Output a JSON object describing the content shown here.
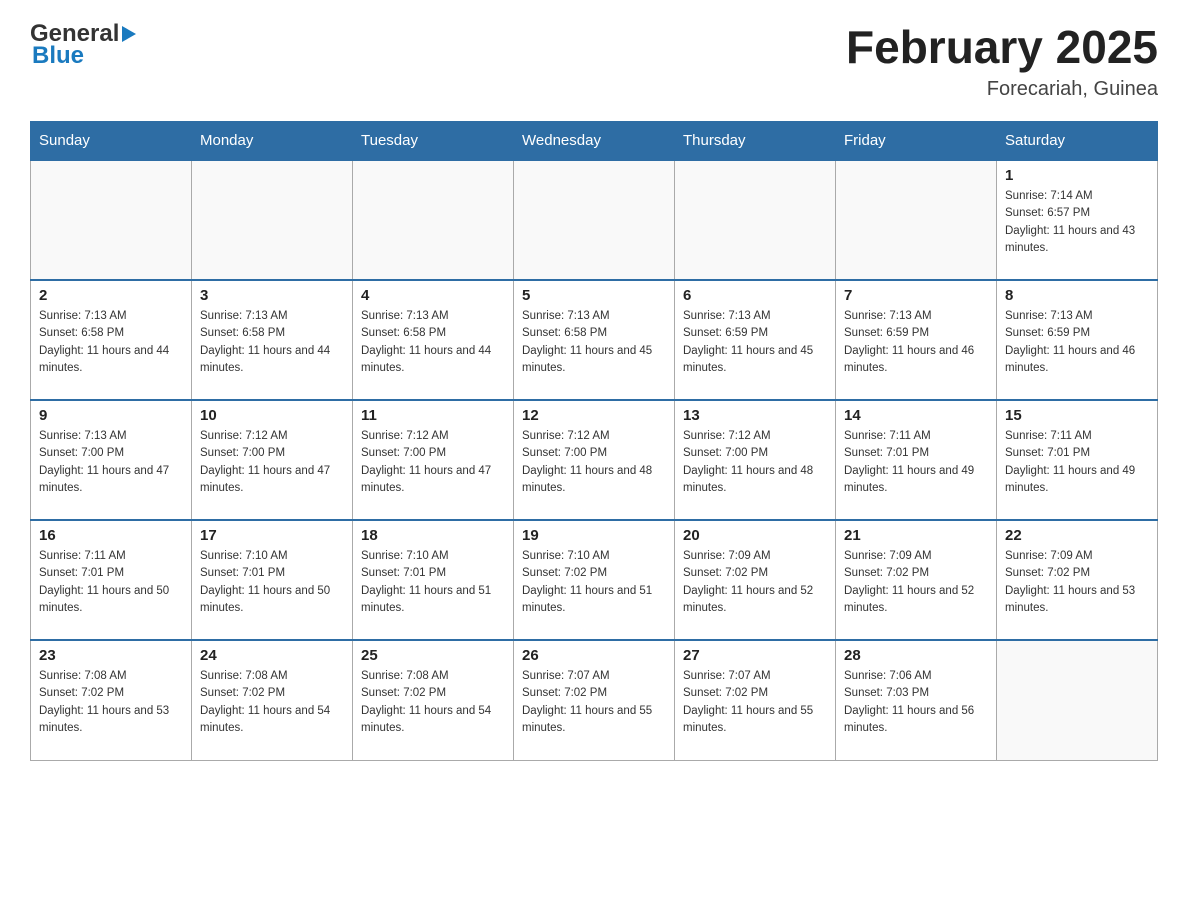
{
  "header": {
    "logo_general": "General",
    "logo_blue": "Blue",
    "month_title": "February 2025",
    "location": "Forecariah, Guinea"
  },
  "weekdays": [
    "Sunday",
    "Monday",
    "Tuesday",
    "Wednesday",
    "Thursday",
    "Friday",
    "Saturday"
  ],
  "weeks": [
    [
      {
        "day": "",
        "sunrise": "",
        "sunset": "",
        "daylight": ""
      },
      {
        "day": "",
        "sunrise": "",
        "sunset": "",
        "daylight": ""
      },
      {
        "day": "",
        "sunrise": "",
        "sunset": "",
        "daylight": ""
      },
      {
        "day": "",
        "sunrise": "",
        "sunset": "",
        "daylight": ""
      },
      {
        "day": "",
        "sunrise": "",
        "sunset": "",
        "daylight": ""
      },
      {
        "day": "",
        "sunrise": "",
        "sunset": "",
        "daylight": ""
      },
      {
        "day": "1",
        "sunrise": "Sunrise: 7:14 AM",
        "sunset": "Sunset: 6:57 PM",
        "daylight": "Daylight: 11 hours and 43 minutes."
      }
    ],
    [
      {
        "day": "2",
        "sunrise": "Sunrise: 7:13 AM",
        "sunset": "Sunset: 6:58 PM",
        "daylight": "Daylight: 11 hours and 44 minutes."
      },
      {
        "day": "3",
        "sunrise": "Sunrise: 7:13 AM",
        "sunset": "Sunset: 6:58 PM",
        "daylight": "Daylight: 11 hours and 44 minutes."
      },
      {
        "day": "4",
        "sunrise": "Sunrise: 7:13 AM",
        "sunset": "Sunset: 6:58 PM",
        "daylight": "Daylight: 11 hours and 44 minutes."
      },
      {
        "day": "5",
        "sunrise": "Sunrise: 7:13 AM",
        "sunset": "Sunset: 6:58 PM",
        "daylight": "Daylight: 11 hours and 45 minutes."
      },
      {
        "day": "6",
        "sunrise": "Sunrise: 7:13 AM",
        "sunset": "Sunset: 6:59 PM",
        "daylight": "Daylight: 11 hours and 45 minutes."
      },
      {
        "day": "7",
        "sunrise": "Sunrise: 7:13 AM",
        "sunset": "Sunset: 6:59 PM",
        "daylight": "Daylight: 11 hours and 46 minutes."
      },
      {
        "day": "8",
        "sunrise": "Sunrise: 7:13 AM",
        "sunset": "Sunset: 6:59 PM",
        "daylight": "Daylight: 11 hours and 46 minutes."
      }
    ],
    [
      {
        "day": "9",
        "sunrise": "Sunrise: 7:13 AM",
        "sunset": "Sunset: 7:00 PM",
        "daylight": "Daylight: 11 hours and 47 minutes."
      },
      {
        "day": "10",
        "sunrise": "Sunrise: 7:12 AM",
        "sunset": "Sunset: 7:00 PM",
        "daylight": "Daylight: 11 hours and 47 minutes."
      },
      {
        "day": "11",
        "sunrise": "Sunrise: 7:12 AM",
        "sunset": "Sunset: 7:00 PM",
        "daylight": "Daylight: 11 hours and 47 minutes."
      },
      {
        "day": "12",
        "sunrise": "Sunrise: 7:12 AM",
        "sunset": "Sunset: 7:00 PM",
        "daylight": "Daylight: 11 hours and 48 minutes."
      },
      {
        "day": "13",
        "sunrise": "Sunrise: 7:12 AM",
        "sunset": "Sunset: 7:00 PM",
        "daylight": "Daylight: 11 hours and 48 minutes."
      },
      {
        "day": "14",
        "sunrise": "Sunrise: 7:11 AM",
        "sunset": "Sunset: 7:01 PM",
        "daylight": "Daylight: 11 hours and 49 minutes."
      },
      {
        "day": "15",
        "sunrise": "Sunrise: 7:11 AM",
        "sunset": "Sunset: 7:01 PM",
        "daylight": "Daylight: 11 hours and 49 minutes."
      }
    ],
    [
      {
        "day": "16",
        "sunrise": "Sunrise: 7:11 AM",
        "sunset": "Sunset: 7:01 PM",
        "daylight": "Daylight: 11 hours and 50 minutes."
      },
      {
        "day": "17",
        "sunrise": "Sunrise: 7:10 AM",
        "sunset": "Sunset: 7:01 PM",
        "daylight": "Daylight: 11 hours and 50 minutes."
      },
      {
        "day": "18",
        "sunrise": "Sunrise: 7:10 AM",
        "sunset": "Sunset: 7:01 PM",
        "daylight": "Daylight: 11 hours and 51 minutes."
      },
      {
        "day": "19",
        "sunrise": "Sunrise: 7:10 AM",
        "sunset": "Sunset: 7:02 PM",
        "daylight": "Daylight: 11 hours and 51 minutes."
      },
      {
        "day": "20",
        "sunrise": "Sunrise: 7:09 AM",
        "sunset": "Sunset: 7:02 PM",
        "daylight": "Daylight: 11 hours and 52 minutes."
      },
      {
        "day": "21",
        "sunrise": "Sunrise: 7:09 AM",
        "sunset": "Sunset: 7:02 PM",
        "daylight": "Daylight: 11 hours and 52 minutes."
      },
      {
        "day": "22",
        "sunrise": "Sunrise: 7:09 AM",
        "sunset": "Sunset: 7:02 PM",
        "daylight": "Daylight: 11 hours and 53 minutes."
      }
    ],
    [
      {
        "day": "23",
        "sunrise": "Sunrise: 7:08 AM",
        "sunset": "Sunset: 7:02 PM",
        "daylight": "Daylight: 11 hours and 53 minutes."
      },
      {
        "day": "24",
        "sunrise": "Sunrise: 7:08 AM",
        "sunset": "Sunset: 7:02 PM",
        "daylight": "Daylight: 11 hours and 54 minutes."
      },
      {
        "day": "25",
        "sunrise": "Sunrise: 7:08 AM",
        "sunset": "Sunset: 7:02 PM",
        "daylight": "Daylight: 11 hours and 54 minutes."
      },
      {
        "day": "26",
        "sunrise": "Sunrise: 7:07 AM",
        "sunset": "Sunset: 7:02 PM",
        "daylight": "Daylight: 11 hours and 55 minutes."
      },
      {
        "day": "27",
        "sunrise": "Sunrise: 7:07 AM",
        "sunset": "Sunset: 7:02 PM",
        "daylight": "Daylight: 11 hours and 55 minutes."
      },
      {
        "day": "28",
        "sunrise": "Sunrise: 7:06 AM",
        "sunset": "Sunset: 7:03 PM",
        "daylight": "Daylight: 11 hours and 56 minutes."
      },
      {
        "day": "",
        "sunrise": "",
        "sunset": "",
        "daylight": ""
      }
    ]
  ]
}
